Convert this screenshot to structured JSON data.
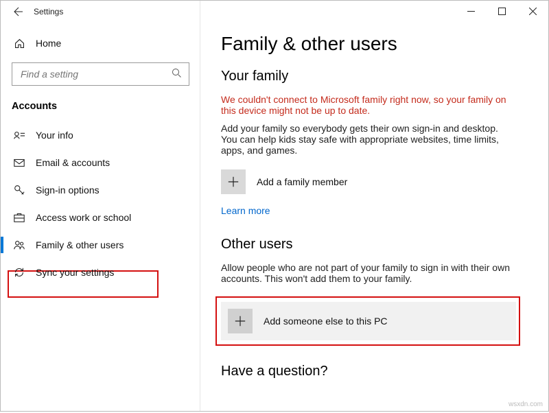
{
  "titlebar": {
    "title": "Settings"
  },
  "sidebar": {
    "home_label": "Home",
    "search_placeholder": "Find a setting",
    "section_label": "Accounts",
    "items": [
      {
        "label": "Your info"
      },
      {
        "label": "Email & accounts"
      },
      {
        "label": "Sign-in options"
      },
      {
        "label": "Access work or school"
      },
      {
        "label": "Family & other users"
      },
      {
        "label": "Sync your settings"
      }
    ]
  },
  "main": {
    "page_title": "Family & other users",
    "family": {
      "heading": "Your family",
      "error": "We couldn't connect to Microsoft family right now, so your family on this device might not be up to date.",
      "desc": "Add your family so everybody gets their own sign-in and desktop. You can help kids stay safe with appropriate websites, time limits, apps, and games.",
      "add_label": "Add a family member",
      "learn_more": "Learn more"
    },
    "other": {
      "heading": "Other users",
      "desc": "Allow people who are not part of your family to sign in with their own accounts. This won't add them to your family.",
      "add_label": "Add someone else to this PC"
    },
    "question_heading": "Have a question?"
  },
  "watermark": "wsxdn.com"
}
